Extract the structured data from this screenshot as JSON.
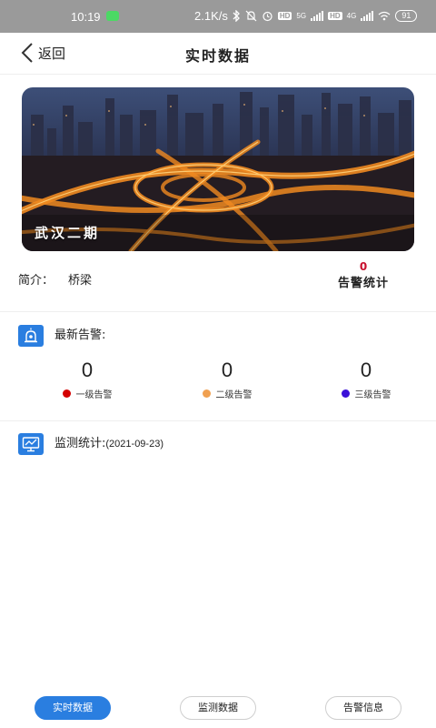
{
  "status_bar": {
    "time": "10:19",
    "speed": "2.1K/s",
    "net1": "5G",
    "net2": "4G",
    "hd": "HD",
    "battery": "91"
  },
  "header": {
    "back_label": "返回",
    "title": "实时数据"
  },
  "project": {
    "caption": "武汉二期",
    "intro_label": "简介：",
    "intro_value": "桥梁",
    "alarm_count": "0",
    "alarm_count_label": "告警统计"
  },
  "latest_alarms": {
    "title": "最新告警:",
    "items": [
      {
        "count": "0",
        "label": "一级告警",
        "color": "#d40000"
      },
      {
        "count": "0",
        "label": "二级告警",
        "color": "#f0a050"
      },
      {
        "count": "0",
        "label": "三级告警",
        "color": "#3a10d8"
      }
    ]
  },
  "monitoring": {
    "title": "监测统计:",
    "date": "(2021-09-23)"
  },
  "tabs": [
    {
      "label": "实时数据",
      "active": true
    },
    {
      "label": "监测数据",
      "active": false
    },
    {
      "label": "告警信息",
      "active": false
    }
  ],
  "icons": {
    "back": "chevron-left-icon",
    "alarm_section": "alarm-lamp-icon",
    "monitor_section": "monitor-chart-icon"
  },
  "colors": {
    "accent": "#2a7ee0",
    "alarm_red": "#c8102e"
  }
}
